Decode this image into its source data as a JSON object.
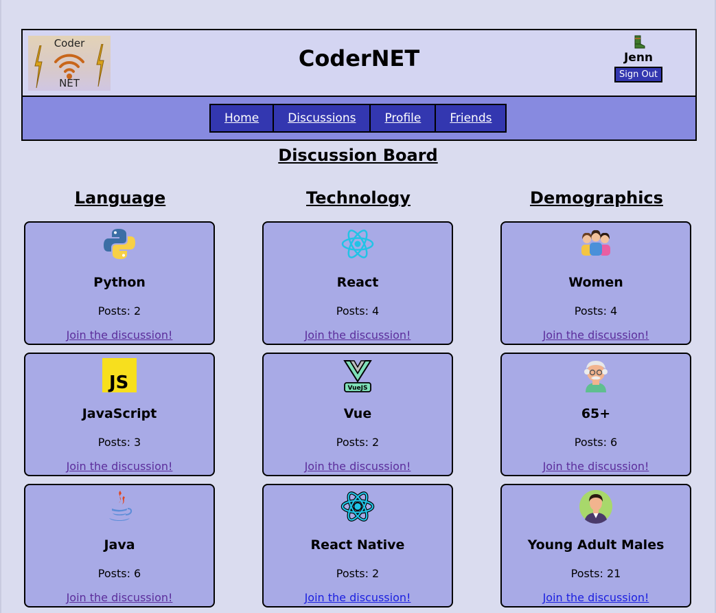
{
  "header": {
    "logo": {
      "top_text": "Coder",
      "bottom_text": "NET"
    },
    "title": "CoderNET",
    "user": {
      "name": "Jenn",
      "signout_label": "Sign Out",
      "icon": "boot-icon"
    }
  },
  "nav": {
    "items": [
      {
        "label": "Home"
      },
      {
        "label": "Discussions"
      },
      {
        "label": "Profile"
      },
      {
        "label": "Friends"
      }
    ]
  },
  "page": {
    "title": "Discussion Board"
  },
  "columns": [
    {
      "heading": "Language",
      "cards": [
        {
          "title": "Python",
          "posts": "Posts: 2",
          "link": "Join the discussion!",
          "icon": "python-icon"
        },
        {
          "title": "JavaScript",
          "posts": "Posts: 3",
          "link": "Join the discussion!",
          "icon": "javascript-icon"
        },
        {
          "title": "Java",
          "posts": "Posts: 6",
          "link": "Join the discussion!",
          "icon": "java-icon"
        }
      ]
    },
    {
      "heading": "Technology",
      "cards": [
        {
          "title": "React",
          "posts": "Posts: 4",
          "link": "Join the discussion!",
          "icon": "react-icon"
        },
        {
          "title": "Vue",
          "posts": "Posts: 2",
          "link": "Join the discussion!",
          "icon": "vuejs-icon",
          "icon_text": "VueJS"
        },
        {
          "title": "React Native",
          "posts": "Posts: 2",
          "link": "Join the discussion!",
          "icon": "react-native-icon"
        }
      ]
    },
    {
      "heading": "Demographics",
      "cards": [
        {
          "title": "Women",
          "posts": "Posts: 4",
          "link": "Join the discussion!",
          "icon": "women-group-icon"
        },
        {
          "title": "65+",
          "posts": "Posts: 6",
          "link": "Join the discussion!",
          "icon": "elderly-man-icon"
        },
        {
          "title": "Young Adult Males",
          "posts": "Posts: 21",
          "link": "Join the discussion!",
          "icon": "young-man-icon"
        }
      ]
    }
  ],
  "colors": {
    "background": "#dadcef",
    "header_bg": "#d4d5f2",
    "nav_bg": "#878ae0",
    "nav_button": "#3337b0",
    "card_bg": "#a8aae6",
    "link_visited": "#5b2d9b",
    "link_unvisited": "#1a1ee0"
  }
}
